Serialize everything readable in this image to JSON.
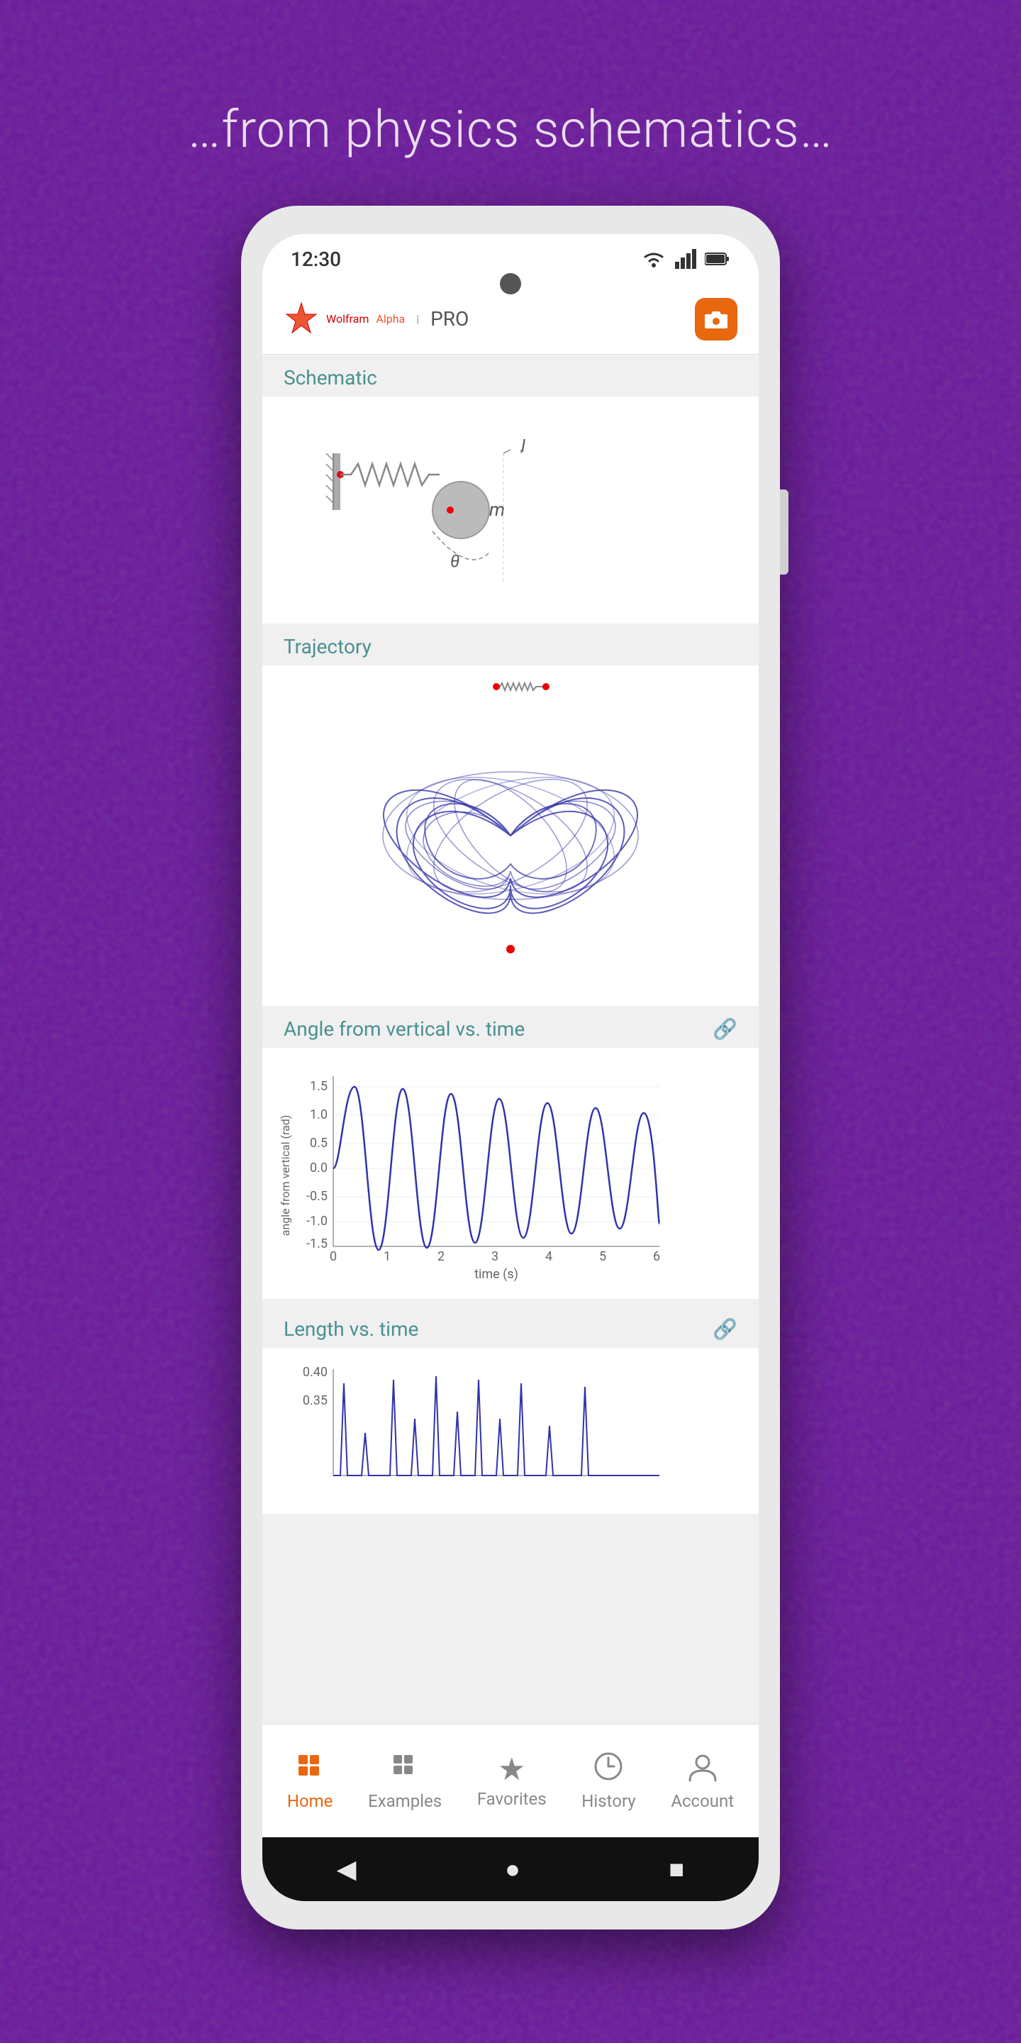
{
  "page": {
    "background_headline": "…from physics schematics…",
    "status_bar": {
      "time": "12:30",
      "wifi_icon": "wifi",
      "signal_icon": "signal",
      "battery_icon": "battery"
    },
    "top_bar": {
      "logo_wolfram": "Wolfram",
      "logo_alpha": "Alpha",
      "logo_divider": "|",
      "logo_pro": "PRO",
      "camera_button_label": "camera"
    },
    "sections": [
      {
        "id": "schematic",
        "header": "Schematic",
        "type": "image"
      },
      {
        "id": "trajectory",
        "header": "Trajectory",
        "type": "image"
      },
      {
        "id": "angle_vs_time",
        "header": "Angle from vertical vs. time",
        "has_link": true,
        "type": "chart"
      },
      {
        "id": "length_vs_time",
        "header": "Length vs. time",
        "has_link": true,
        "type": "chart"
      }
    ],
    "bottom_nav": {
      "items": [
        {
          "id": "home",
          "label": "Home",
          "icon": "⊞",
          "active": true
        },
        {
          "id": "examples",
          "label": "Examples",
          "icon": "⊞",
          "active": false
        },
        {
          "id": "favorites",
          "label": "Favorites",
          "icon": "★",
          "active": false
        },
        {
          "id": "history",
          "label": "History",
          "icon": "🕐",
          "active": false
        },
        {
          "id": "account",
          "label": "Account",
          "icon": "👤",
          "active": false
        }
      ]
    },
    "system_nav": {
      "back_label": "◀",
      "home_label": "●",
      "recent_label": "■"
    }
  }
}
